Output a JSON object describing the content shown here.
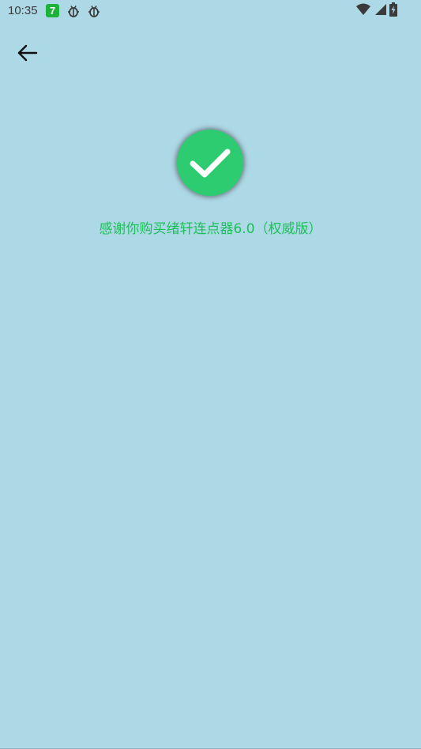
{
  "status_bar": {
    "time": "10:35",
    "app_badge": "7",
    "notification_icons": [
      "bug-icon",
      "bug-icon"
    ],
    "system_icons": [
      "wifi-icon",
      "signal-icon",
      "battery-charging-icon"
    ]
  },
  "toolbar": {
    "back_icon": "arrow-left-icon"
  },
  "main": {
    "success_icon": "check-circle-icon",
    "thanks_message": "感谢你购买绪轩连点器6.0（权威版）"
  },
  "colors": {
    "background": "#add8e6",
    "success_green": "#2ecc71",
    "message_green": "#1dbf5a"
  }
}
